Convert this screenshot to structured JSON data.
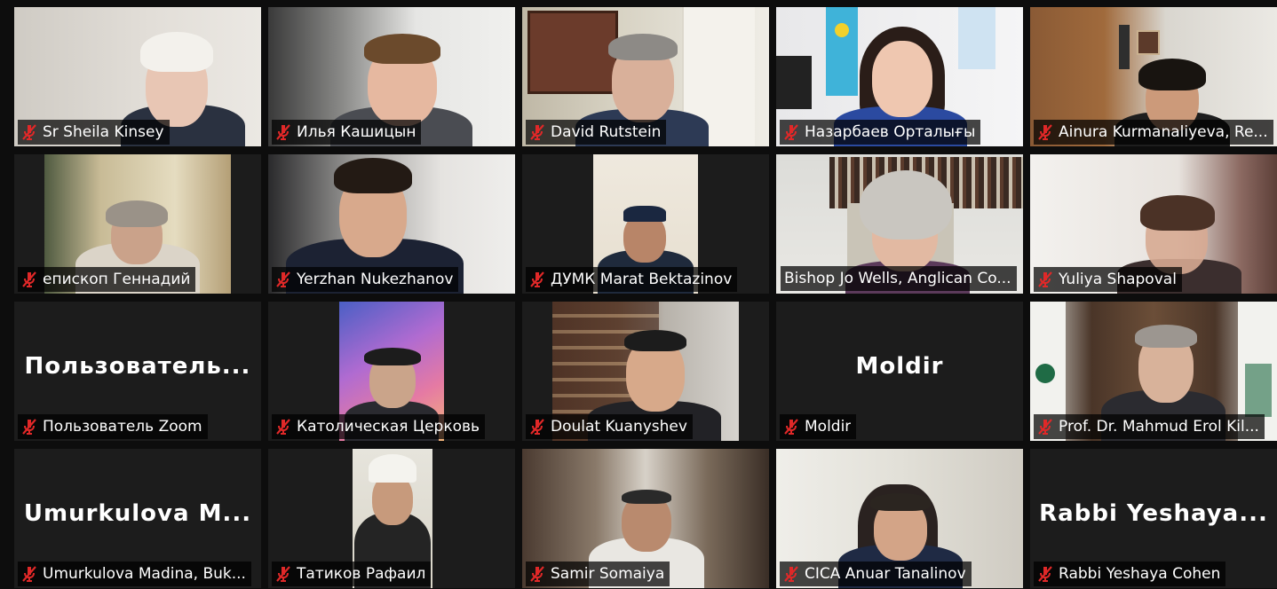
{
  "participants": [
    {
      "name": "Sr Sheila Kinsey",
      "muted": true,
      "video": true
    },
    {
      "name": "Илья Кашицын",
      "muted": true,
      "video": true
    },
    {
      "name": "David Rutstein",
      "muted": true,
      "video": true
    },
    {
      "name": "Назарбаев Орталығы",
      "muted": true,
      "video": true
    },
    {
      "name": "Ainura Kurmanaliyeva, Re...",
      "muted": true,
      "video": true
    },
    {
      "name": "епископ Геннадий",
      "muted": true,
      "video": true
    },
    {
      "name": "Yerzhan Nukezhanov",
      "muted": true,
      "video": true
    },
    {
      "name": "ДУМК Marat Bektazinov",
      "muted": true,
      "video": true
    },
    {
      "name": "Bishop Jo Wells, Anglican Co...",
      "muted": false,
      "video": true,
      "speaking": true
    },
    {
      "name": "Yuliya Shapoval",
      "muted": true,
      "video": true
    },
    {
      "name": "Пользователь Zoom",
      "muted": true,
      "video": false,
      "placeholder": "Пользователь..."
    },
    {
      "name": "Католическая Церковь",
      "muted": true,
      "video": true
    },
    {
      "name": "Doulat Kuanyshev",
      "muted": true,
      "video": true
    },
    {
      "name": "Moldir",
      "muted": true,
      "video": false,
      "placeholder": "Moldir"
    },
    {
      "name": "Prof. Dr. Mahmud Erol Kil...",
      "muted": true,
      "video": true
    },
    {
      "name": "Umurkulova Madina, Buk...",
      "muted": true,
      "video": false,
      "placeholder": "Umurkulova M..."
    },
    {
      "name": "Татиков Рафаил",
      "muted": true,
      "video": true
    },
    {
      "name": "Samir Somaiya",
      "muted": true,
      "video": true
    },
    {
      "name": "CICA Anuar Tanalinov",
      "muted": true,
      "video": true
    },
    {
      "name": "Rabbi Yeshaya Cohen",
      "muted": true,
      "video": false,
      "placeholder": "Rabbi  Yeshaya..."
    }
  ],
  "colors": {
    "muted_icon": "#e02828",
    "active_speaker_border": "#e8ee6a",
    "tile_background": "#1c1c1c",
    "page_background": "#0d0d0d"
  },
  "icons": {
    "muted": "microphone-muted-icon"
  }
}
